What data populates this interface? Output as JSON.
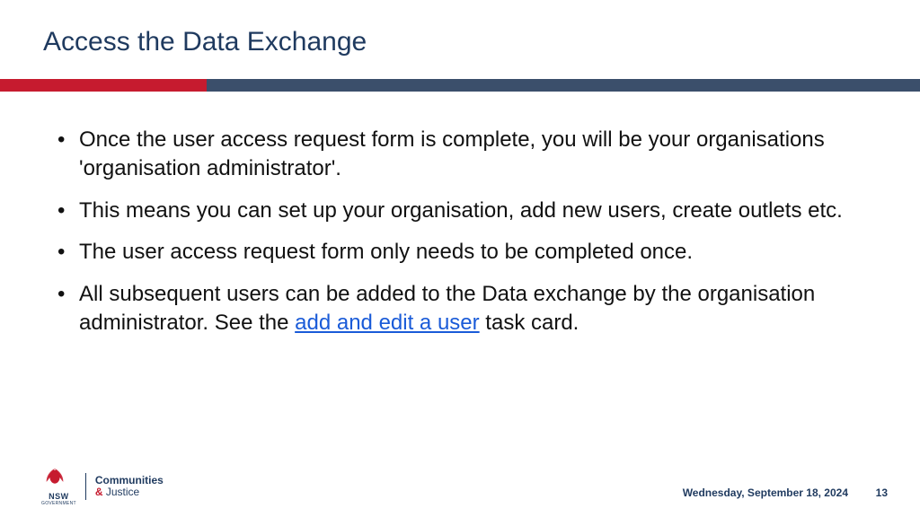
{
  "title": "Access the Data Exchange",
  "bullets": [
    {
      "text": "Once the user access request form is complete, you will be your organisations 'organisation administrator'."
    },
    {
      "text": "This means you can set up your organisation, add new users, create outlets etc."
    },
    {
      "text": "The user access request form only needs to be completed once."
    },
    {
      "pre": "All subsequent users can be added to the Data exchange by the organisation administrator. See the ",
      "link": "add and edit a user",
      "post": " task card."
    }
  ],
  "logo": {
    "nsw": "NSW",
    "gov": "GOVERNMENT",
    "dept_line1": "Communities",
    "dept_amp": "&",
    "dept_line2": " Justice"
  },
  "footer": {
    "date": "Wednesday, September 18, 2024",
    "page": "13"
  }
}
